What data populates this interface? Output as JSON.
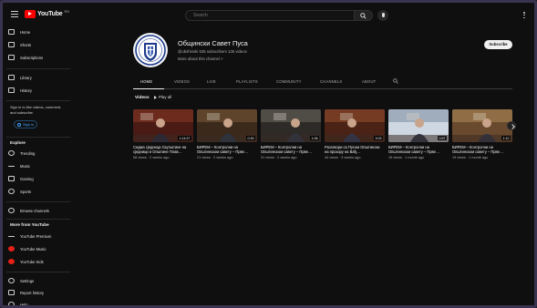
{
  "app": {
    "logo_text": "YouTube",
    "logo_sup": "RS"
  },
  "search": {
    "placeholder": "Search"
  },
  "sidebar": {
    "main": [
      {
        "label": "Home",
        "icon": "home-icon"
      },
      {
        "label": "Shorts",
        "icon": "shorts-icon"
      },
      {
        "label": "Subscriptions",
        "icon": "subscriptions-icon"
      }
    ],
    "library": [
      {
        "label": "Library",
        "icon": "library-icon"
      },
      {
        "label": "History",
        "icon": "history-icon"
      }
    ],
    "signin_text": "Sign in to like videos, comment, and subscribe.",
    "signin_button": "Sign in",
    "explore_title": "Explore",
    "explore": [
      {
        "label": "Trending",
        "icon": "trending-icon"
      },
      {
        "label": "Music",
        "icon": "music-icon"
      },
      {
        "label": "Gaming",
        "icon": "gaming-icon"
      },
      {
        "label": "Sports",
        "icon": "sports-icon"
      }
    ],
    "browse": {
      "label": "Browse channels",
      "icon": "browse-channels-icon"
    },
    "more_title": "More from YouTube",
    "more": [
      {
        "label": "YouTube Premium",
        "icon": "youtube-premium-icon"
      },
      {
        "label": "YouTube Music",
        "icon": "youtube-music-icon"
      },
      {
        "label": "YouTube Kids",
        "icon": "youtube-kids-icon"
      }
    ],
    "bottom": [
      {
        "label": "Settings",
        "icon": "settings-icon"
      },
      {
        "label": "Report history",
        "icon": "flag-icon"
      },
      {
        "label": "Help",
        "icon": "help-icon"
      }
    ]
  },
  "channel": {
    "name": "Общински Савет Пуса",
    "meta": "@obshinski  535 subscribers  135 videos",
    "more": "More about this channel  >",
    "subscribe": "Subscribe"
  },
  "tabs": [
    "HOME",
    "VIDEOS",
    "LIVE",
    "PLAYLISTS",
    "COMMUNITY",
    "CHANNELS",
    "ABOUT"
  ],
  "section": {
    "title": "Videos",
    "play_all": "Play all"
  },
  "videos": [
    {
      "title": "Седма сједница Скупштине на сједници и Општине Плав…",
      "meta": "58 views · 2 weeks ago",
      "duration": "1:14:27"
    },
    {
      "title": "БИРЕМ – Контролни на Општинском савету – Прве…",
      "meta": "21 views · 2 weeks ago",
      "duration": "0:39"
    },
    {
      "title": "БИРЕМ – Контролни на Општинском савету – Прве…",
      "meta": "31 views · 2 weeks ago",
      "duration": "1:08"
    },
    {
      "title": "Разговори са Пусом Општински на прозору на Вађ…",
      "meta": "44 views · 3 weeks ago",
      "duration": "3:03"
    },
    {
      "title": "БИРЕМ – Контролни на Општинском савету – Прве…",
      "meta": "15 views · 1 month ago",
      "duration": "0:57"
    },
    {
      "title": "БИРЕМ – Контролни на Општинском савету – Прве…",
      "meta": "19 views · 1 month ago",
      "duration": "1:12"
    }
  ]
}
